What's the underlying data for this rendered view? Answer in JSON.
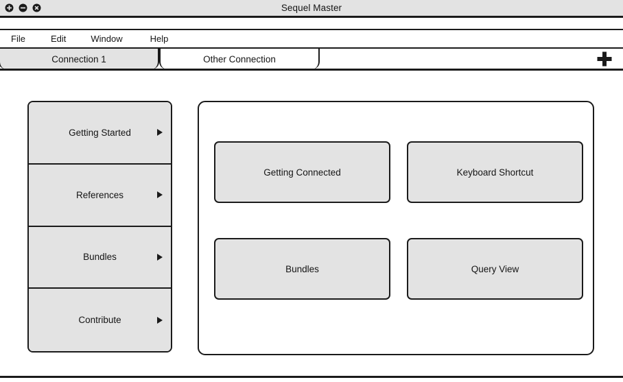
{
  "window": {
    "title": "Sequel Master",
    "controls": [
      {
        "name": "maximize-button",
        "glyph": "+"
      },
      {
        "name": "minimize-button",
        "glyph": "−"
      },
      {
        "name": "close-button",
        "glyph": "×"
      }
    ]
  },
  "menubar": {
    "items": [
      {
        "label": "File"
      },
      {
        "label": "Edit"
      },
      {
        "label": "Window"
      },
      {
        "label": "Help"
      }
    ]
  },
  "tabs": {
    "items": [
      {
        "label": "Connection 1",
        "active": true
      },
      {
        "label": "Other Connection",
        "active": false
      }
    ],
    "add_tab_glyph": "+"
  },
  "sidebar": {
    "items": [
      {
        "label": "Getting Started"
      },
      {
        "label": "References"
      },
      {
        "label": "Bundles"
      },
      {
        "label": "Contribute"
      }
    ]
  },
  "main": {
    "cards": [
      {
        "label": "Getting Connected"
      },
      {
        "label": "Keyboard Shortcut"
      },
      {
        "label": "Bundles"
      },
      {
        "label": "Query View"
      }
    ]
  },
  "colors": {
    "chrome": "#e3e3e3",
    "surface": "#ffffff",
    "outline": "#1a1a1a",
    "text": "#141414"
  }
}
